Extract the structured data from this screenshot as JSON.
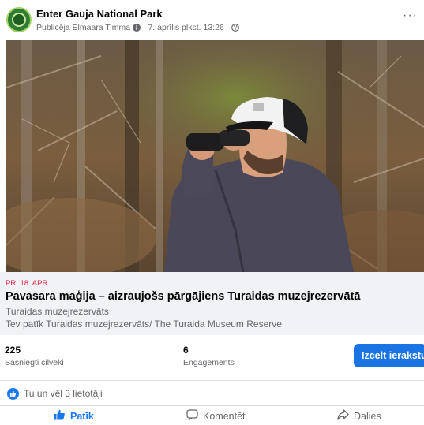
{
  "post": {
    "page_name": "Enter Gauja National Park",
    "meta_text": "Publicēja Elmaara Timma",
    "timestamp": "· 7. aprīlis plkst. 13:26 ·",
    "more_label": "···"
  },
  "event": {
    "date": "PR, 18. APR.",
    "title": "Pavasara maģija – aizraujošs pārgājiens Turaidas muzejrezervātā",
    "organizer": "Turaidas muzejrezervāts",
    "liked_by": "Tev patīk Turaidas muzejrezervāts/ The Turaida Museum Reserve"
  },
  "stats": {
    "reached_value": "225",
    "reached_label": "Sasniegti cilvēki",
    "engagements_value": "6",
    "engagements_label": "Engagements",
    "boost_label": "Izcelt ierakstu"
  },
  "reactions": {
    "text": "Tu un vēl 3 lietotāji"
  },
  "actions": {
    "like": "Patīk",
    "comment": "Komentēt",
    "share": "Dalies"
  },
  "colors": {
    "accent": "#1877f2",
    "boost": "#1b74e4",
    "date": "#e41e3f",
    "muted": "#65676b"
  }
}
